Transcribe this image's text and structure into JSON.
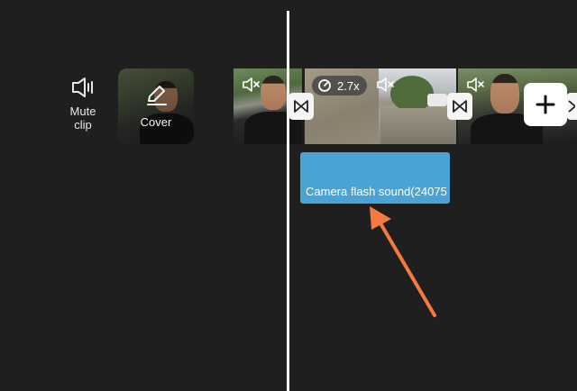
{
  "toolbar": {
    "mute_label_line1": "Mute",
    "mute_label_line2": "clip",
    "cover_label": "Cover"
  },
  "timeline": {
    "speed_label": "2.7x",
    "audio_clip_label": "Camera flash sound(24075"
  },
  "colors": {
    "background": "#1f1f1f",
    "audio_clip": "#4aa3d6",
    "annotation_arrow": "#f47a3f",
    "playhead": "#f4f4f4"
  }
}
